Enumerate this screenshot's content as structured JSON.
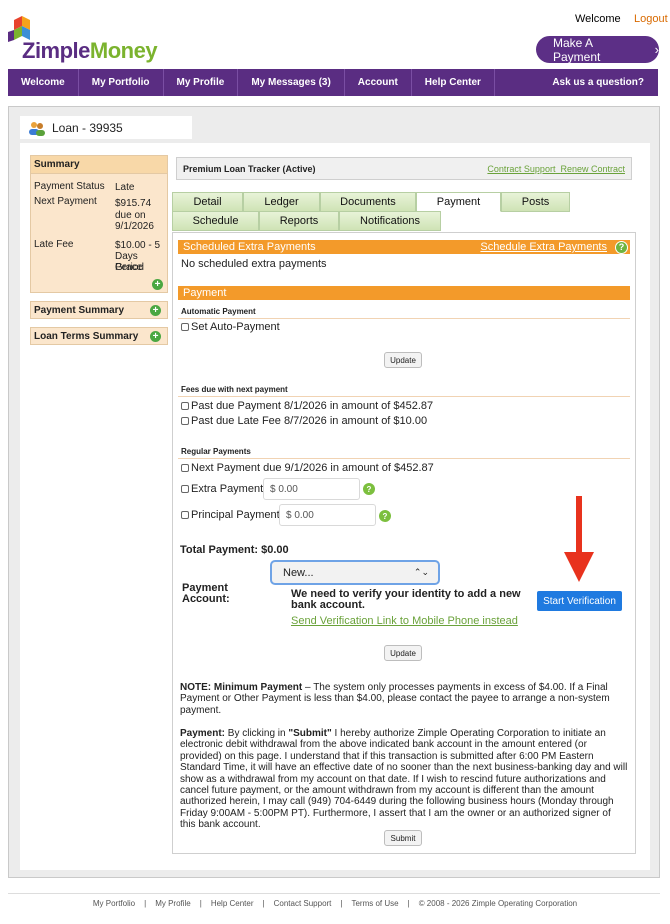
{
  "header": {
    "brand_part1": "Zimple",
    "brand_part2": "Money",
    "welcome": "Welcome",
    "logout": "Logout",
    "make_payment": "Make A Payment",
    "make_payment_icon": "chevron-right-icon"
  },
  "nav": {
    "items": [
      "Welcome",
      "My Portfolio",
      "My Profile",
      "My Messages (3)",
      "Account",
      "Help Center"
    ],
    "ask": "Ask us a question?"
  },
  "loan": {
    "title": "Loan - 39935",
    "icon": "users-icon"
  },
  "summary": {
    "title": "Summary",
    "status_label": "Payment Status",
    "status_value": "Late",
    "next_label": "Next Payment",
    "next_value_1": "$915.74",
    "next_value_2": "due on",
    "next_value_3": "9/1/2026",
    "late_label": "Late Fee",
    "late_value_1": "$10.00 - 5",
    "late_value_2": "Days Grace",
    "late_value_3": "Period"
  },
  "payment_summary": "Payment Summary",
  "loan_terms_summary": "Loan Terms Summary",
  "tracker": {
    "title": "Premium Loan Tracker (Active)",
    "link1": "Contract Support",
    "link2": "Renew Contract"
  },
  "tabs": {
    "row1": [
      "Detail",
      "Ledger",
      "Documents",
      "Payment",
      "Posts"
    ],
    "row2": [
      "Schedule",
      "Reports",
      "Notifications"
    ],
    "active": "Payment"
  },
  "scheduled": {
    "title": "Scheduled Extra Payments",
    "link": "Schedule Extra Payments",
    "empty": "No scheduled extra payments"
  },
  "payment": {
    "title": "Payment",
    "auto_heading": "Automatic Payment",
    "auto_label": "Set Auto-Payment",
    "update": "Update",
    "fees_heading": "Fees due with next payment",
    "fee1": "Past due Payment 8/1/2026 in amount of $452.87",
    "fee2": "Past due Late Fee 8/7/2026 in amount of $10.00",
    "regular_heading": "Regular Payments",
    "next_payment": "Next Payment due 9/1/2026 in amount of $452.87",
    "extra_label": "Extra Payment",
    "extra_value": "$ 0.00",
    "principal_label": "Principal Payment",
    "principal_value": "$ 0.00",
    "total": "Total Payment: $0.00",
    "account_label_1": "Payment",
    "account_label_2": "Account:",
    "account_select": "New...",
    "verify_msg_1": "We need to verify your identity to add a new",
    "verify_msg_2": "bank account.",
    "start_verification": "Start Verification",
    "send_link": "Send Verification Link to Mobile Phone instead",
    "update2": "Update",
    "note_bold": "NOTE: Minimum Payment",
    "note_text": " – The system only processes payments in excess of $4.00. If a Final Payment or Other Payment is less than $4.00, please contact the payee to arrange a non-system payment.",
    "auth_bold": "Payment:",
    "auth_text_1": " By clicking in ",
    "auth_submit": "\"Submit\"",
    "auth_text_2": " I hereby authorize Zimple Operating Corporation to initiate an electronic debit withdrawal from the above indicated bank account in the amount entered (or provided) on this page. I understand that if this transaction is submitted after 6:00 PM Eastern Standard Time, it will have an effective date of no sooner than the next business-banking day and will show as a withdrawal from my account on that date. If I wish to rescind future authorizations and cancel future payment, or the amount withdrawn from my account is different than the amount authorized herein, I may call (949) 704-6449 during the following business hours (Monday through Friday 9:00AM - 5:00PM PT). Furthermore, I assert that I am the owner or an authorized signer of this bank account.",
    "submit": "Submit"
  },
  "footer": {
    "links": [
      "My Portfolio",
      "My Profile",
      "Help Center",
      "Contact Support",
      "Terms of Use"
    ],
    "copyright": "© 2008 - 2026 Zimple Operating Corporation"
  },
  "colors": {
    "brand_purple": "#5a2d82",
    "brand_green": "#7bb32e",
    "orange": "#f39a2a",
    "accent_blue": "#1f7ae0",
    "arrow_red": "#e8321d"
  }
}
